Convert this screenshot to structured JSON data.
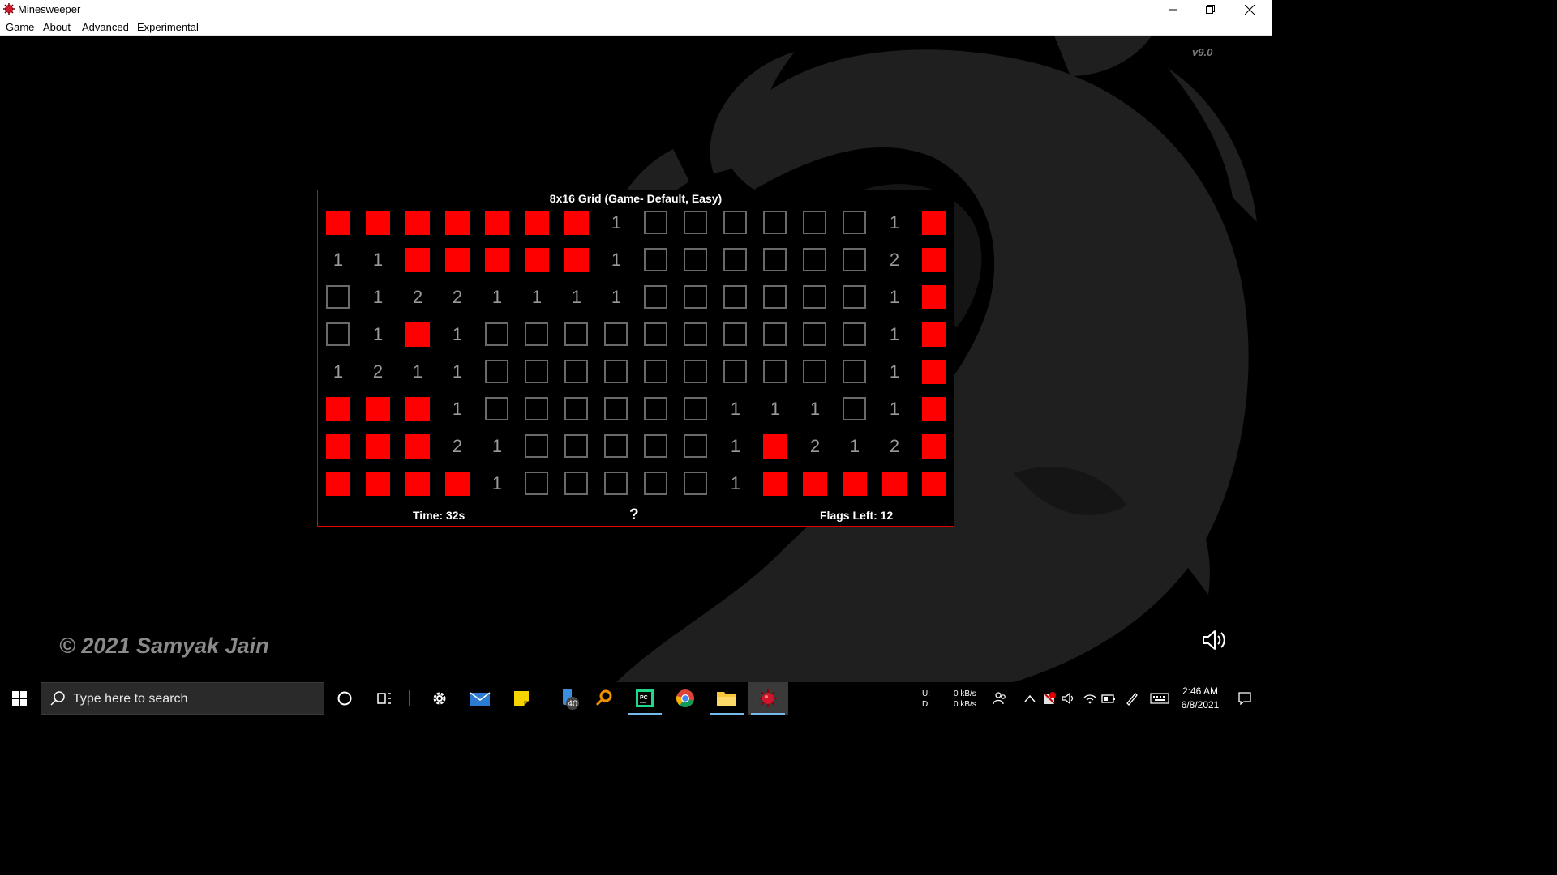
{
  "window": {
    "title": "Minesweeper"
  },
  "menu": [
    "Game",
    "About",
    "Advanced",
    "Experimental"
  ],
  "version": "v9.0",
  "copyright": "© 2021 Samyak Jain",
  "board": {
    "title": "8x16 Grid (Game- Default, Easy)",
    "time": "Time: 32s",
    "help": "?",
    "flags_left": "Flags Left: 12",
    "legend": {
      "F": "flag",
      "H": "hidden",
      "number": "revealed count"
    },
    "rows": [
      [
        "F",
        "F",
        "F",
        "F",
        "F",
        "F",
        "F",
        "1",
        "H",
        "H",
        "H",
        "H",
        "H",
        "H",
        "1",
        "F"
      ],
      [
        "1",
        "1",
        "F",
        "F",
        "F",
        "F",
        "F",
        "1",
        "H",
        "H",
        "H",
        "H",
        "H",
        "H",
        "2",
        "F"
      ],
      [
        "H",
        "1",
        "2",
        "2",
        "1",
        "1",
        "1",
        "1",
        "H",
        "H",
        "H",
        "H",
        "H",
        "H",
        "1",
        "F"
      ],
      [
        "H",
        "1",
        "F",
        "1",
        "H",
        "H",
        "H",
        "H",
        "H",
        "H",
        "H",
        "H",
        "H",
        "H",
        "1",
        "F"
      ],
      [
        "1",
        "2",
        "1",
        "1",
        "H",
        "H",
        "H",
        "H",
        "H",
        "H",
        "H",
        "H",
        "H",
        "H",
        "1",
        "F"
      ],
      [
        "F",
        "F",
        "F",
        "1",
        "H",
        "H",
        "H",
        "H",
        "H",
        "H",
        "1",
        "1",
        "1",
        "H",
        "1",
        "F"
      ],
      [
        "F",
        "F",
        "F",
        "2",
        "1",
        "H",
        "H",
        "H",
        "H",
        "H",
        "1",
        "F",
        "2",
        "1",
        "2",
        "F"
      ],
      [
        "F",
        "F",
        "F",
        "F",
        "1",
        "H",
        "H",
        "H",
        "H",
        "H",
        "1",
        "F",
        "F",
        "F",
        "F",
        "F"
      ]
    ]
  },
  "taskbar": {
    "search_placeholder": "Type here to search",
    "badge": "40",
    "net": {
      "up_label": "U:",
      "down_label": "D:",
      "up": "0 kB/s",
      "down": "0 kB/s"
    },
    "time": "2:46 AM",
    "date": "6/8/2021"
  },
  "colors": {
    "flag": "#ff0000",
    "board_border": "#e60000",
    "hidden_border": "#6a6a6a"
  }
}
